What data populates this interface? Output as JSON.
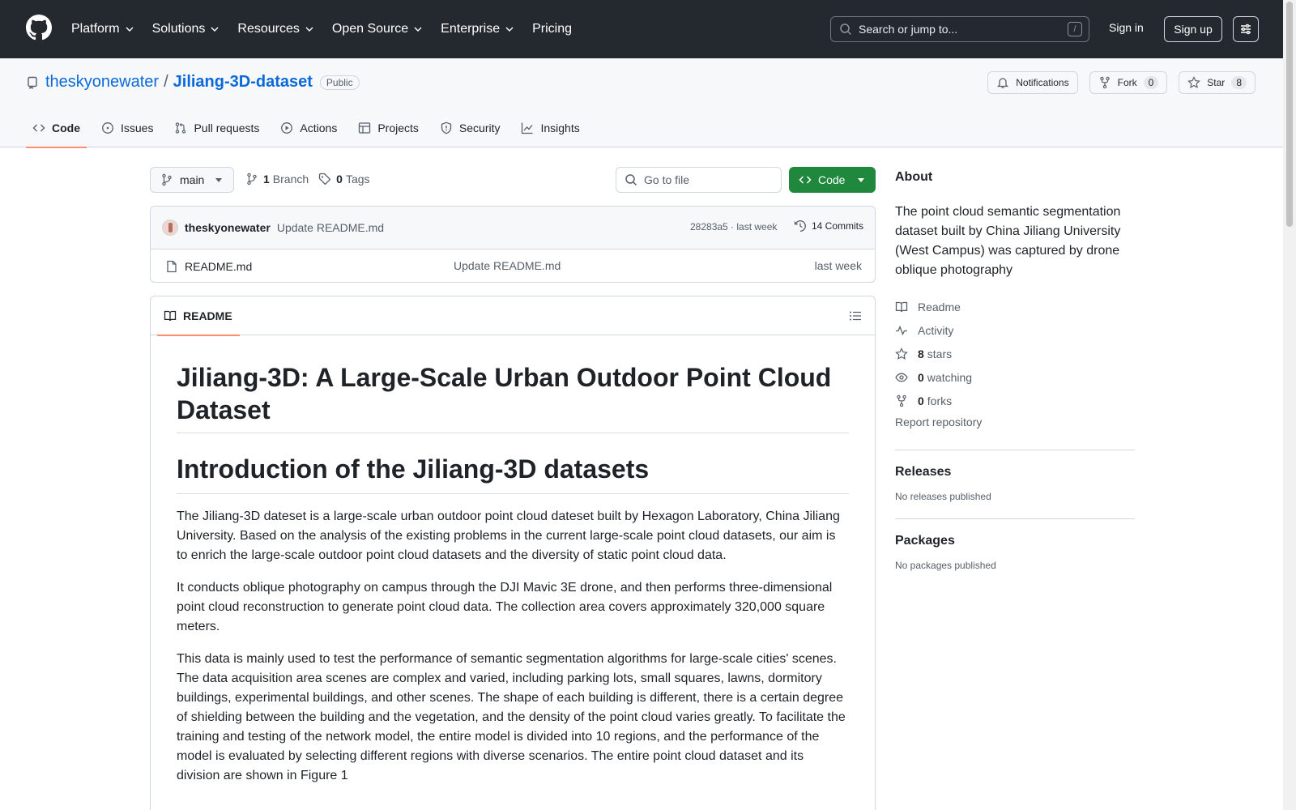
{
  "header": {
    "nav": [
      "Platform",
      "Solutions",
      "Resources",
      "Open Source",
      "Enterprise",
      "Pricing"
    ],
    "search_placeholder": "Search or jump to...",
    "search_shortcut": "/",
    "signin": "Sign in",
    "signup": "Sign up"
  },
  "repo": {
    "owner": "theskyonewater",
    "separator": "/",
    "name": "Jiliang-3D-dataset",
    "visibility": "Public",
    "notifications_label": "Notifications",
    "fork_label": "Fork",
    "fork_count": "0",
    "star_label": "Star",
    "star_count": "8",
    "tabs": [
      "Code",
      "Issues",
      "Pull requests",
      "Actions",
      "Projects",
      "Security",
      "Insights"
    ],
    "active_tab": "Code"
  },
  "filenav": {
    "branch": "main",
    "branch_count": "1",
    "branch_label": "Branch",
    "tag_count": "0",
    "tag_label": "Tags",
    "goto_placeholder": "Go to file",
    "code_button": "Code"
  },
  "commit": {
    "author": "theskyonewater",
    "message": "Update README.md",
    "meta": "28283a5 · last week",
    "commits_label": "14 Commits"
  },
  "files": [
    {
      "name": "README.md",
      "message": "Update README.md",
      "age": "last week"
    }
  ],
  "readme": {
    "tab_label": "README",
    "title": "Jiliang-3D: A Large-Scale Urban Outdoor Point Cloud Dataset",
    "intro_heading": "Introduction of the Jiliang-3D datasets",
    "paragraphs": [
      "The Jiliang-3D dateset is a large-scale urban outdoor point cloud dateset built by Hexagon Laboratory, China Jiliang University. Based on the analysis of the existing problems in the current large-scale point cloud datasets, our aim is to enrich the large-scale outdoor point cloud datasets and the diversity of static point cloud data.",
      "It conducts oblique photography on campus through the DJI Mavic 3E drone, and then performs three-dimensional point cloud reconstruction to generate point cloud data. The collection area covers approximately 320,000 square meters.",
      "This data is mainly used to test the performance of semantic segmentation algorithms for large-scale cities' scenes. The data acquisition area scenes are complex and varied, including parking lots, small squares, lawns, dormitory buildings, experimental buildings, and other scenes. The shape of each building is different, there is a certain degree of shielding between the building and the vegetation, and the density of the point cloud varies greatly. To facilitate the training and testing of the network model, the entire model is divided into 10 regions, and the performance of the model is evaluated by selecting different regions with diverse scenarios. The entire point cloud dataset and its division are shown in Figure 1"
    ]
  },
  "about": {
    "heading": "About",
    "description": "The point cloud semantic segmentation dataset built by China Jiliang University (West Campus) was captured by drone oblique photography",
    "readme": "Readme",
    "activity": "Activity",
    "stars_count": "8",
    "stars_label": "stars",
    "watching_count": "0",
    "watching_label": "watching",
    "forks_count": "0",
    "forks_label": "forks",
    "report": "Report repository"
  },
  "releases": {
    "heading": "Releases",
    "text": "No releases published"
  },
  "packages": {
    "heading": "Packages",
    "text": "No packages published"
  }
}
